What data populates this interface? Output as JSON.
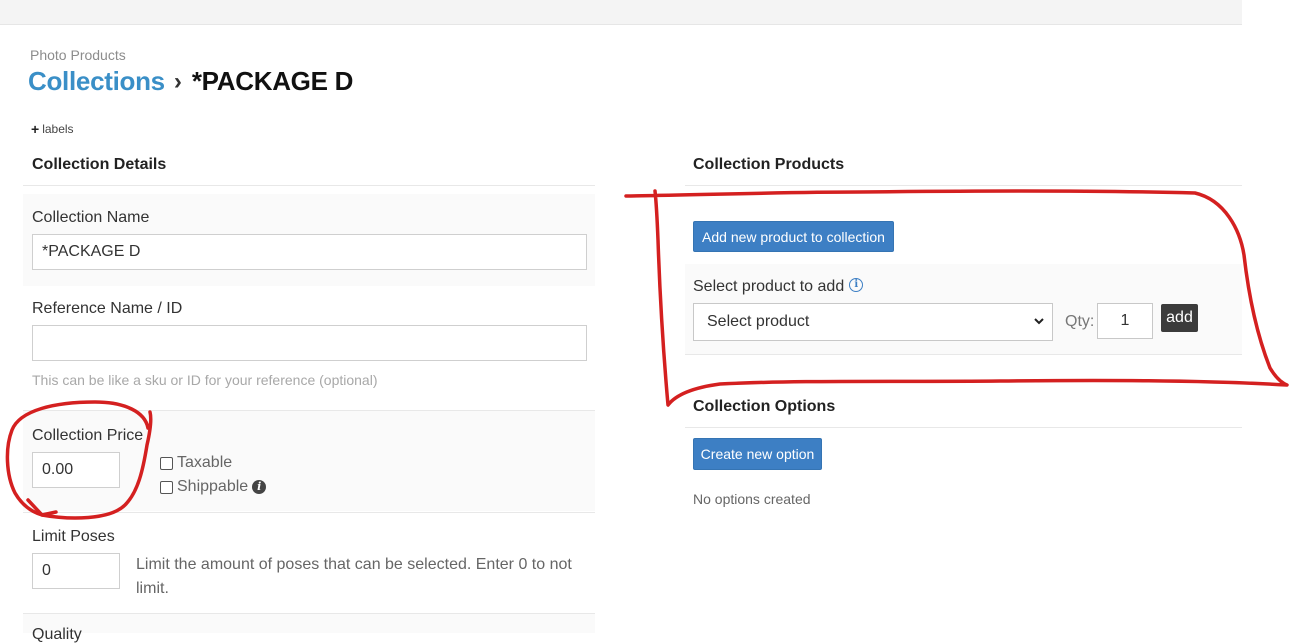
{
  "breadcrumb": {
    "section": "Photo Products",
    "parent": "Collections",
    "separator": "›",
    "current": "*PACKAGE D"
  },
  "labels_link": {
    "icon": "plus-icon",
    "label": "labels"
  },
  "details": {
    "title": "Collection Details",
    "name_label": "Collection Name",
    "name_value": "*PACKAGE D",
    "ref_label": "Reference Name / ID",
    "ref_value": "",
    "ref_help": "This can be like a sku or ID for your reference (optional)",
    "price_label": "Collection Price",
    "price_value": "0.00",
    "taxable_label": "Taxable",
    "taxable_checked": false,
    "shippable_label": "Shippable",
    "shippable_checked": false,
    "shippable_info_icon": "info-icon",
    "limit_label": "Limit Poses",
    "limit_value": "0",
    "limit_help": "Limit the amount of poses that can be selected. Enter 0 to not limit.",
    "next_label_partial": "Quality"
  },
  "products": {
    "title": "Collection Products",
    "add_new_button": "Add new product to collection",
    "select_label": "Select product to add",
    "select_info_icon": "info-icon",
    "select_value": "Select product",
    "qty_label": "Qty:",
    "qty_value": "1",
    "add_button": "add"
  },
  "options": {
    "title": "Collection Options",
    "create_button": "Create new option",
    "empty_text": "No options created"
  },
  "colors": {
    "link_blue": "#3a8fc7",
    "button_blue": "#3d7fc4",
    "annotation_red": "#d42020"
  }
}
